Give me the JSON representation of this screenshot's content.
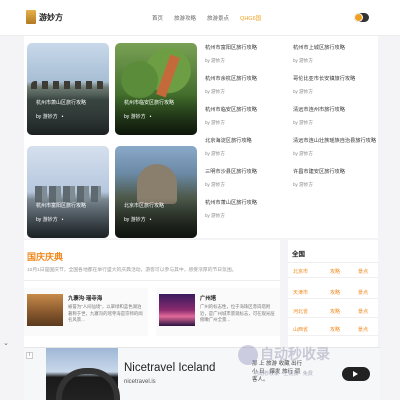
{
  "header": {
    "logo_text": "游妙方",
    "nav": [
      "首页",
      "旅游攻略",
      "旅游景点",
      "QHG6国"
    ]
  },
  "cards": [
    {
      "title": "杭州市萧山区旅行攻略",
      "author": "by 游妙方",
      "dot": "•"
    },
    {
      "title": "杭州市临安区旅行攻略",
      "author": "by 游妙方",
      "dot": "•"
    },
    {
      "title": "杭州市富阳区旅行攻略",
      "author": "by 游妙方",
      "dot": "•"
    },
    {
      "title": "北京市区旅行攻略",
      "author": "by 游妙方",
      "dot": "•"
    }
  ],
  "list_col1": [
    {
      "title": "杭州市富阳区旅行攻略",
      "author": "by 游妙方"
    },
    {
      "title": "杭州市余杭区旅行攻略",
      "author": "by 游妙方"
    },
    {
      "title": "杭州市临安区旅行攻略",
      "author": "by 游妙方"
    },
    {
      "title": "北京海淀区旅行攻略",
      "author": "by 游妙方"
    },
    {
      "title": "三明市沙县区旅行攻略",
      "author": "by 游妙方"
    },
    {
      "title": "杭州市萧山区旅行攻略",
      "author": "by 游妙方"
    }
  ],
  "list_col2": [
    {
      "title": "杭州市上城区旅行攻略",
      "author": "by 游妙方"
    },
    {
      "title": "哥伦比亚市长安镇旅行攻略",
      "author": "by 游妙方"
    },
    {
      "title": "清远市连州市旅行攻略",
      "author": "by 游妙方"
    },
    {
      "title": "清远市连山壮族瑶族自治县旅行攻略",
      "author": "by 游妙方"
    },
    {
      "title": "许昌市建安区旅行攻略",
      "author": "by 游妙方"
    }
  ],
  "festival": {
    "title": "国庆庆典",
    "desc": "10月1日是国庆节，全国各地都在举行盛大的庆典活动，游客可以参与其中，感受浓厚的节日氛围。",
    "items": [
      {
        "title": "九寨沟·瑶寺海",
        "text": "被誉为\"人间仙境\"，以翠绿和蓝色湖泊著称于世，九寨沟的瑶寺海是宗师的闻名风景..."
      },
      {
        "title": "广州塔",
        "text": "广州的标志性，位于海珠区赤岗塔附近，是广州城市景观标志，可在观光层俯瞰广州全景..."
      }
    ]
  },
  "side": {
    "title": "全国",
    "rows": [
      [
        "北京市",
        "攻略",
        "景点"
      ],
      [
        "天津市",
        "攻略",
        "景点"
      ],
      [
        "河北省",
        "攻略",
        "景点"
      ],
      [
        "山西省",
        "攻略",
        "景点"
      ]
    ]
  },
  "ad": {
    "title": "Nicetravel Iceland",
    "domain": "nicetravel.is",
    "mid_text": "那 上 旅游 收藏 出行\n小 日 · 爆发 旅行 调\n客人。",
    "corner": "i"
  },
  "watermark": {
    "text": "自动秒收录",
    "sub": "自动秒收录 · 上链接 · 免费"
  },
  "colors": {
    "accent": "#f08a20"
  }
}
